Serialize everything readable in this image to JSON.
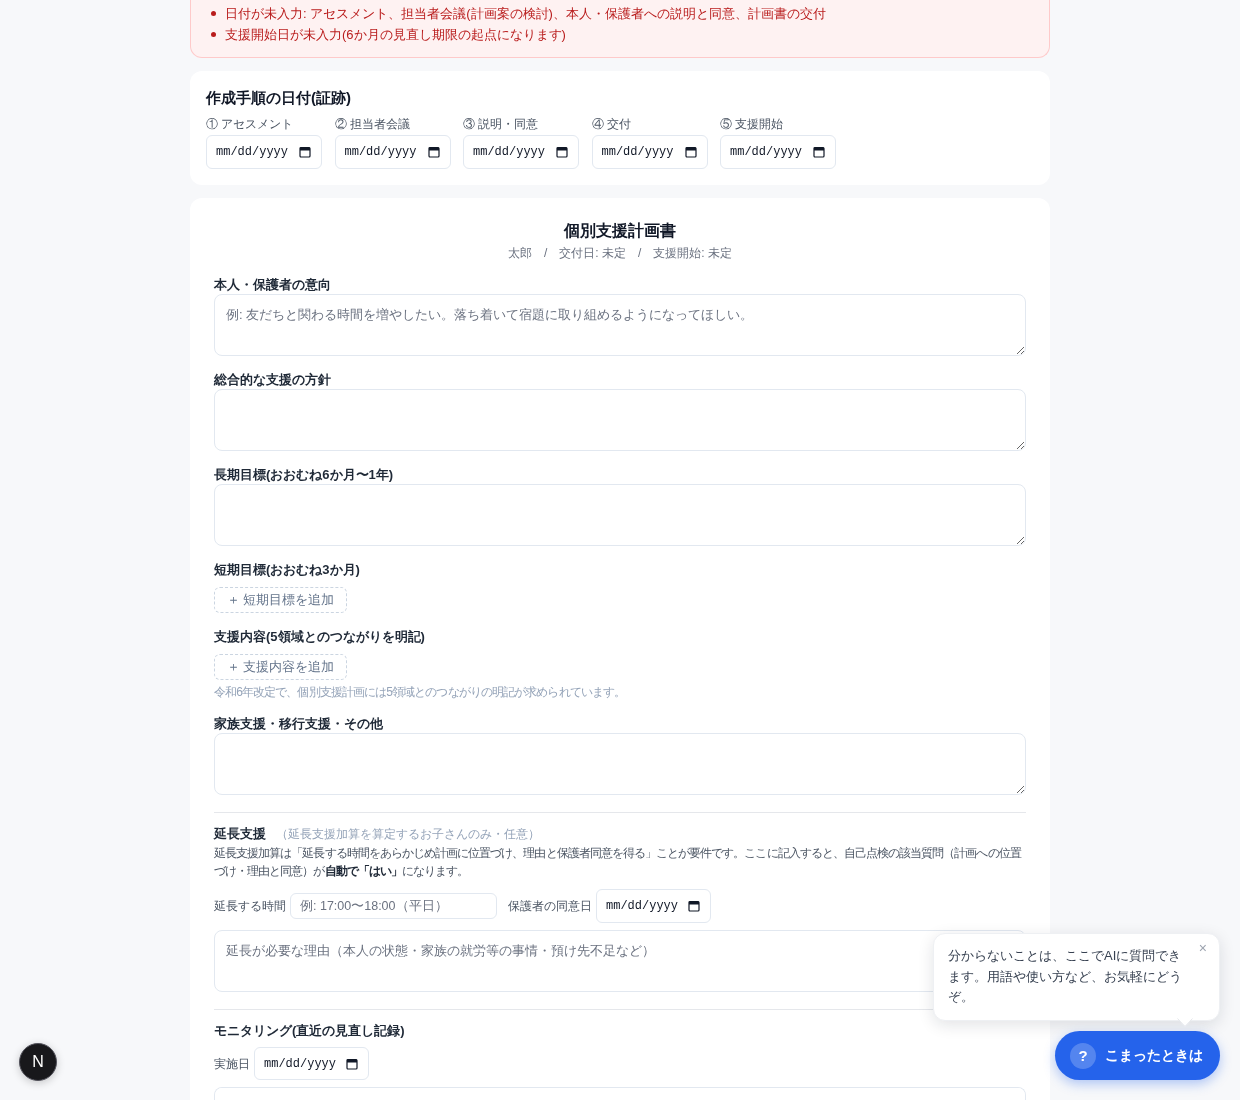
{
  "alert": {
    "items": [
      "日付が未入力: アセスメント、担当者会議(計画案の検討)、本人・保護者への説明と同意、計画書の交付",
      "支援開始日が未入力(6か月の見直し期限の起点になります)"
    ]
  },
  "process_dates": {
    "title": "作成手順の日付(証跡)",
    "fields": [
      {
        "label": "① アセスメント",
        "placeholder": "mm/dd/yyyy"
      },
      {
        "label": "② 担当者会議",
        "placeholder": "mm/dd/yyyy"
      },
      {
        "label": "③ 説明・同意",
        "placeholder": "mm/dd/yyyy"
      },
      {
        "label": "④ 交付",
        "placeholder": "mm/dd/yyyy"
      },
      {
        "label": "⑤ 支援開始",
        "placeholder": "mm/dd/yyyy"
      }
    ]
  },
  "plan": {
    "title": "個別支援計画書",
    "meta": "太郎　/　交付日: 未定　/　支援開始: 未定",
    "sections": [
      {
        "kind": "textarea",
        "label": "本人・保護者の意向",
        "placeholder": "例: 友だちと関わる時間を増やしたい。落ち着いて宿題に取り組めるようになってほしい。"
      },
      {
        "kind": "textarea",
        "label": "総合的な支援の方針"
      },
      {
        "kind": "textarea",
        "label": "長期目標(おおむね6か月〜1年)"
      },
      {
        "kind": "add_list",
        "label": "短期目標(おおむね3か月)",
        "button": "＋ 短期目標を追加"
      },
      {
        "kind": "add_list",
        "label": "支援内容(5領域とのつながりを明記)",
        "button": "＋ 支援内容を追加",
        "note": "令和6年改定で、個別支援計画には5領域とのつながりの明記が求められています。"
      },
      {
        "kind": "textarea",
        "label": "家族支援・移行支援・その他"
      },
      {
        "kind": "extension",
        "label": "延長支援",
        "note": "（延長支援加算を算定するお子さんのみ・任意）",
        "description": "延長支援加算は「延長する時間をあらかじめ計画に位置づけ、理由と保護者同意を得る」ことが要件です。ここに記入すると、自己点検の該当質問（計画への位置づけ・理由と同意）が**自動で「はい」**になります。",
        "time_label": "延長する時間",
        "time_placeholder": "例: 17:00〜18:00（平日）",
        "consent_label": "保護者の同意日",
        "consent_placeholder": "mm/dd/yyyy",
        "reason_placeholder": "延長が必要な理由（本人の状態・家族の就労等の事情・預け先不足など）"
      },
      {
        "kind": "monitoring",
        "label": "モニタリング(直近の見直し記録)",
        "date_label": "実施日",
        "date_placeholder": "mm/dd/yyyy"
      }
    ]
  },
  "help": {
    "tooltip": {
      "text": "分からないことは、ここでAIに質問できます。用語や使い方など、お気軽にどうぞ。",
      "close": "×"
    },
    "button": {
      "badge": "?",
      "label": "こまったときは"
    }
  },
  "dev_indicator": {
    "label": "N"
  }
}
